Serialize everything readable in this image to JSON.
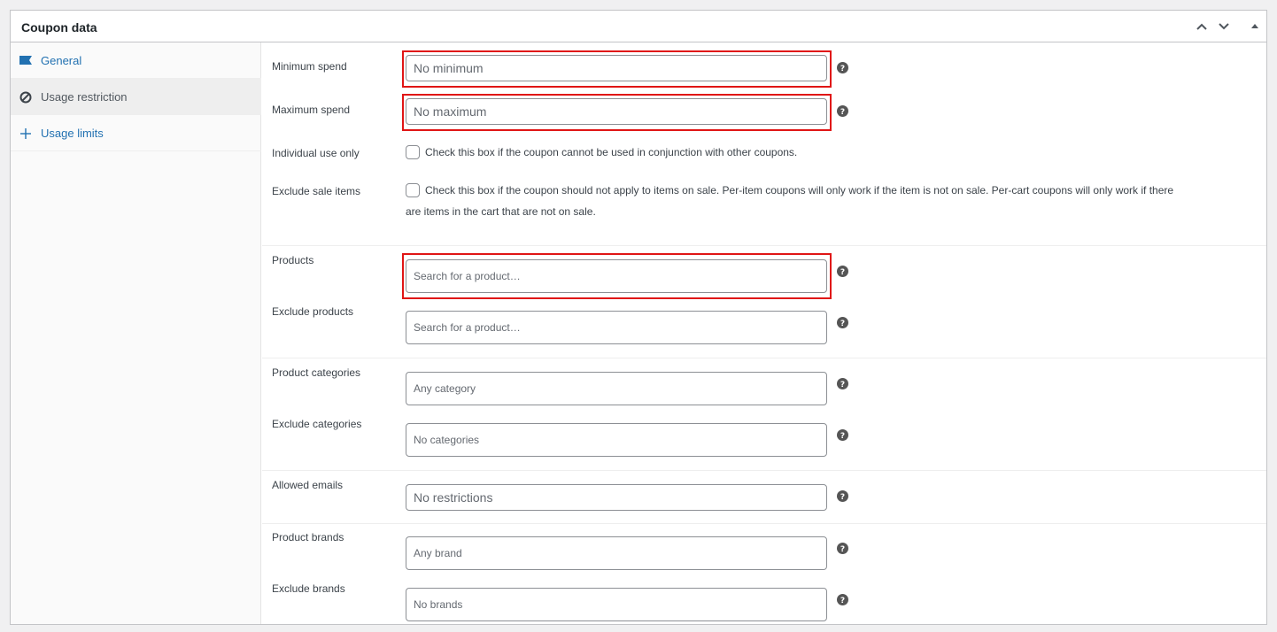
{
  "panel": {
    "title": "Coupon data",
    "controls": {
      "up_icon": "chevron-up-icon",
      "down_icon": "chevron-down-icon",
      "toggle_icon": "triangle-up-icon"
    }
  },
  "tabs": [
    {
      "label": "General",
      "icon": "ticket-icon",
      "active": false
    },
    {
      "label": "Usage restriction",
      "icon": "no-entry-icon",
      "active": true
    },
    {
      "label": "Usage limits",
      "icon": "crosshair-icon",
      "active": false
    }
  ],
  "fields": {
    "minimum_spend": {
      "label": "Minimum spend",
      "placeholder": "No minimum"
    },
    "maximum_spend": {
      "label": "Maximum spend",
      "placeholder": "No maximum"
    },
    "individual_use": {
      "label": "Individual use only",
      "text": "Check this box if the coupon cannot be used in conjunction with other coupons.",
      "checked": false
    },
    "exclude_sale": {
      "label": "Exclude sale items",
      "text_line1": "Check this box if the coupon should not apply to items on sale. Per-item coupons will only work if the item is not on sale. Per-cart coupons will only work if there",
      "text_line2": "are items in the cart that are not on sale.",
      "checked": false
    },
    "products": {
      "label": "Products",
      "placeholder": "Search for a product…"
    },
    "exclude_products": {
      "label": "Exclude products",
      "placeholder": "Search for a product…"
    },
    "product_categories": {
      "label": "Product categories",
      "placeholder": "Any category"
    },
    "exclude_categories": {
      "label": "Exclude categories",
      "placeholder": "No categories"
    },
    "allowed_emails": {
      "label": "Allowed emails",
      "placeholder": "No restrictions"
    },
    "product_brands": {
      "label": "Product brands",
      "placeholder": "Any brand"
    },
    "exclude_brands": {
      "label": "Exclude brands",
      "placeholder": "No brands"
    }
  },
  "colors": {
    "link": "#2271b1",
    "highlight": "#e01515",
    "help_icon": "#555555"
  }
}
